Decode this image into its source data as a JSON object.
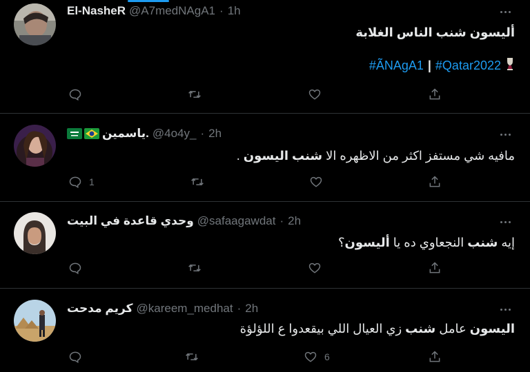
{
  "tweets": [
    {
      "name": "El-NasheR",
      "handle": "@A7medNAgA1",
      "dot": "·",
      "time": "1h",
      "text": "أليسون شنب الناس الغلابة",
      "hashtag1": "#ÃNAgA1",
      "separator": "|",
      "hashtag2": "#Qatar2022",
      "reply_count": "",
      "retweet_count": "",
      "like_count": ""
    },
    {
      "name": "ياسمين.",
      "flags": [
        "saudi-flag",
        "brazil-flag"
      ],
      "handle": "@4o4y_",
      "dot": "·",
      "time": "2h",
      "text_prefix": "مافيه شي مستفز اكثر من الاظهره الا ",
      "text_bold": "شنب اليسون",
      "text_suffix": " .",
      "reply_count": "1",
      "retweet_count": "",
      "like_count": ""
    },
    {
      "name": "وحدي قاعدة في البيت",
      "handle": "@safaagawdat",
      "dot": "·",
      "time": "2h",
      "text_prefix": "إيه ",
      "text_bold1": "شنب",
      "text_mid": " النجعاوي ده يا ",
      "text_bold2": "أليسون",
      "text_suffix": "؟",
      "reply_count": "",
      "retweet_count": "",
      "like_count": ""
    },
    {
      "name": "كريم مدحت",
      "handle": "@kareem_medhat",
      "dot": "·",
      "time": "2h",
      "text_bold1": "اليسون",
      "text_mid1": " عامل ",
      "text_bold2": "شنب",
      "text_suffix": " زي العيال اللي بيقعدوا ع اللؤلؤة",
      "reply_count": "",
      "retweet_count": "",
      "like_count": "6"
    }
  ],
  "colors": {
    "background": "#000000",
    "text": "#e7e9ea",
    "secondary": "#71767b",
    "link": "#1d9bf0",
    "divider": "#2f3336"
  },
  "icons": {
    "reply": "reply-icon",
    "retweet": "retweet-icon",
    "like": "like-icon",
    "share": "share-icon",
    "more": "more-icon",
    "trophy": "world-cup-trophy-icon"
  }
}
